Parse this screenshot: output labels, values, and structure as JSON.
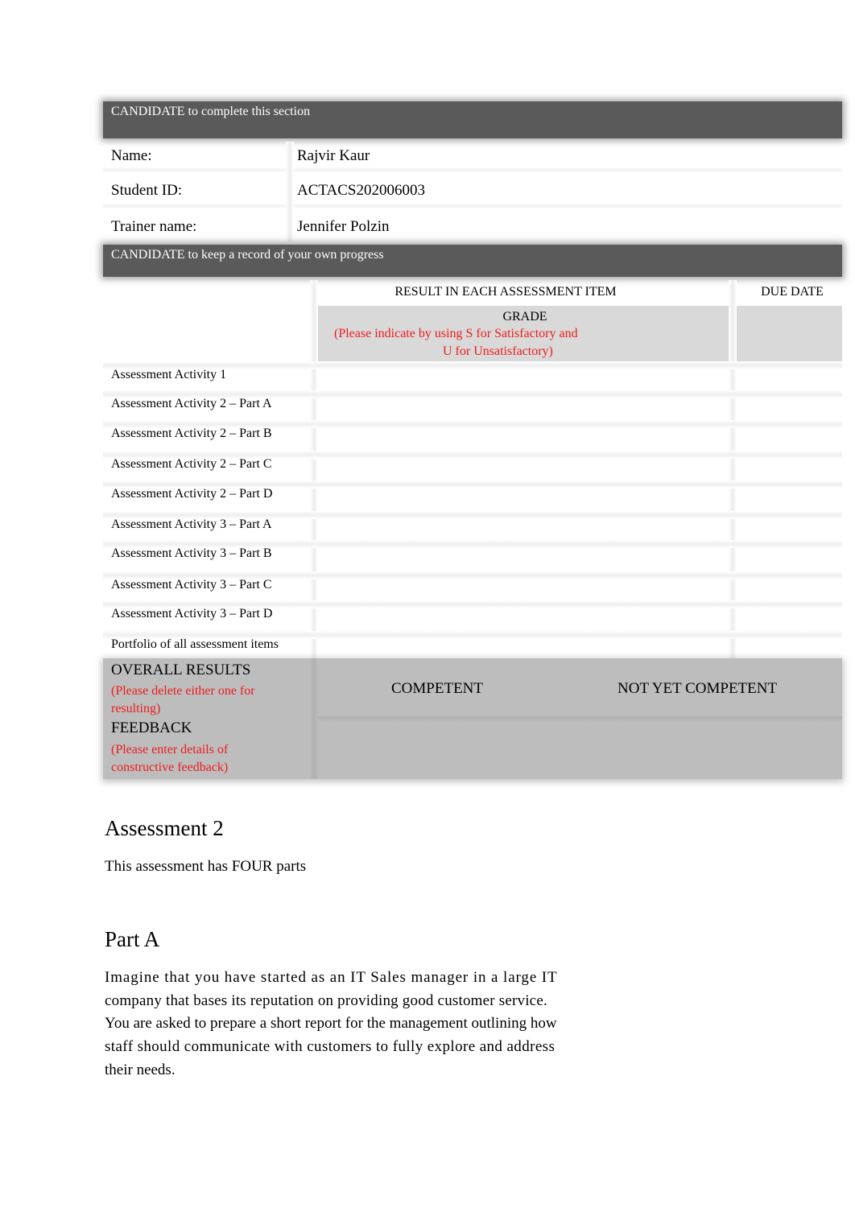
{
  "candidate_section": {
    "header": "CANDIDATE to complete this section",
    "fields": [
      {
        "label": "Name:",
        "value": "Rajvir Kaur"
      },
      {
        "label": "Student ID:",
        "value": "ACTACS202006003"
      },
      {
        "label": "Trainer name:",
        "value": "Jennifer Polzin"
      }
    ]
  },
  "progress_section": {
    "header": "CANDIDATE to keep a record of your own progress",
    "columns": {
      "result": "RESULT IN EACH ASSESSMENT ITEM",
      "due_date": "DUE DATE",
      "grade": "GRADE",
      "grade_note_1": "(Please indicate by using S for Satisfactory and",
      "grade_note_2": "U for Unsatisfactory)"
    },
    "activities": [
      {
        "label": "Assessment Activity 1",
        "grade": "",
        "due_date": ""
      },
      {
        "label": "Assessment Activity 2 – Part A",
        "grade": "",
        "due_date": ""
      },
      {
        "label": "Assessment Activity 2 – Part B",
        "grade": "",
        "due_date": ""
      },
      {
        "label": "Assessment Activity 2 – Part C",
        "grade": "",
        "due_date": ""
      },
      {
        "label": "Assessment Activity 2 – Part D",
        "grade": "",
        "due_date": ""
      },
      {
        "label": "Assessment Activity 3 – Part A",
        "grade": "",
        "due_date": ""
      },
      {
        "label": "Assessment Activity 3 – Part B",
        "grade": "",
        "due_date": ""
      },
      {
        "label": "Assessment Activity 3 – Part C",
        "grade": "",
        "due_date": ""
      },
      {
        "label": "Assessment Activity 3 – Part D",
        "grade": "",
        "due_date": ""
      },
      {
        "label": "Portfolio of all assessment items",
        "grade": "",
        "due_date": ""
      }
    ],
    "overall": {
      "label": "OVERALL RESULTS",
      "note_1": "(Please delete either one for",
      "note_2": "resulting)",
      "competent": "COMPETENT",
      "not_yet_competent": "NOT YET COMPETENT"
    },
    "feedback": {
      "label": "FEEDBACK",
      "note_1": "(Please enter details of",
      "note_2": "constructive feedback)",
      "value": ""
    }
  },
  "assessment": {
    "title": "Assessment 2",
    "intro": "This assessment has FOUR parts",
    "part_title": "Part A",
    "part_text_lines": [
      "Imagine that you have started as an IT Sales manager in a large IT",
      "company that bases its reputation on providing good customer service.",
      "You are asked to prepare a short report for the management outlining how",
      "staff should communicate with customers to fully explore and address",
      "their needs."
    ]
  },
  "colors": {
    "header_bar": "#5a5a5a",
    "note_red": "#ee1c1c",
    "grade_header_bg": "#d9d9d9",
    "overall_bg": "#bdbdbd"
  }
}
